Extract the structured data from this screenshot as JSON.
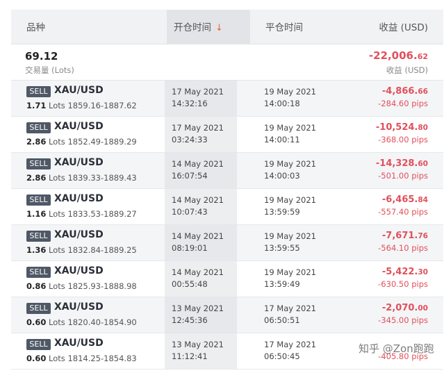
{
  "header": {
    "col_instrument": "品种",
    "col_open_time": "开仓时间",
    "sort_arrow": "↓",
    "col_close_time": "平仓时间",
    "col_profit": "收益 (USD)"
  },
  "summary": {
    "lots": "69.12",
    "lots_label": "交易量 (Lots)",
    "total_int": "-22,006.",
    "total_dec": "62",
    "total_label": "收益 (USD)"
  },
  "trades": [
    {
      "side": "SELL",
      "symbol": "XAU/USD",
      "lots": "1.71",
      "lots_unit": "Lots",
      "range": "1859.16-1887.62",
      "open_date": "17 May 2021",
      "open_time": "14:32:16",
      "close_date": "19 May 2021",
      "close_time": "14:00:18",
      "pl_int": "-4,866.",
      "pl_dec": "66",
      "pips": "-284.60 pips"
    },
    {
      "side": "SELL",
      "symbol": "XAU/USD",
      "lots": "2.86",
      "lots_unit": "Lots",
      "range": "1852.49-1889.29",
      "open_date": "17 May 2021",
      "open_time": "03:24:33",
      "close_date": "19 May 2021",
      "close_time": "14:00:11",
      "pl_int": "-10,524.",
      "pl_dec": "80",
      "pips": "-368.00 pips"
    },
    {
      "side": "SELL",
      "symbol": "XAU/USD",
      "lots": "2.86",
      "lots_unit": "Lots",
      "range": "1839.33-1889.43",
      "open_date": "14 May 2021",
      "open_time": "16:07:54",
      "close_date": "19 May 2021",
      "close_time": "14:00:03",
      "pl_int": "-14,328.",
      "pl_dec": "60",
      "pips": "-501.00 pips"
    },
    {
      "side": "SELL",
      "symbol": "XAU/USD",
      "lots": "1.16",
      "lots_unit": "Lots",
      "range": "1833.53-1889.27",
      "open_date": "14 May 2021",
      "open_time": "10:07:43",
      "close_date": "19 May 2021",
      "close_time": "13:59:59",
      "pl_int": "-6,465.",
      "pl_dec": "84",
      "pips": "-557.40 pips"
    },
    {
      "side": "SELL",
      "symbol": "XAU/USD",
      "lots": "1.36",
      "lots_unit": "Lots",
      "range": "1832.84-1889.25",
      "open_date": "14 May 2021",
      "open_time": "08:19:01",
      "close_date": "19 May 2021",
      "close_time": "13:59:55",
      "pl_int": "-7,671.",
      "pl_dec": "76",
      "pips": "-564.10 pips"
    },
    {
      "side": "SELL",
      "symbol": "XAU/USD",
      "lots": "0.86",
      "lots_unit": "Lots",
      "range": "1825.93-1888.98",
      "open_date": "14 May 2021",
      "open_time": "00:55:48",
      "close_date": "19 May 2021",
      "close_time": "13:59:49",
      "pl_int": "-5,422.",
      "pl_dec": "30",
      "pips": "-630.50 pips"
    },
    {
      "side": "SELL",
      "symbol": "XAU/USD",
      "lots": "0.60",
      "lots_unit": "Lots",
      "range": "1820.40-1854.90",
      "open_date": "13 May 2021",
      "open_time": "12:45:36",
      "close_date": "17 May 2021",
      "close_time": "06:50:51",
      "pl_int": "-2,070.",
      "pl_dec": "00",
      "pips": "-345.00 pips"
    },
    {
      "side": "SELL",
      "symbol": "XAU/USD",
      "lots": "0.60",
      "lots_unit": "Lots",
      "range": "1814.25-1854.83",
      "open_date": "13 May 2021",
      "open_time": "11:12:41",
      "close_date": "17 May 2021",
      "close_time": "06:50:45",
      "pl_int": "",
      "pl_dec": "",
      "pips": "-405.80 pips"
    }
  ],
  "watermark": "知乎 @Zon跑跑",
  "colors": {
    "loss_red": "#e0505b",
    "badge_bg": "#4f5866",
    "sort_arrow": "#e8623c"
  }
}
